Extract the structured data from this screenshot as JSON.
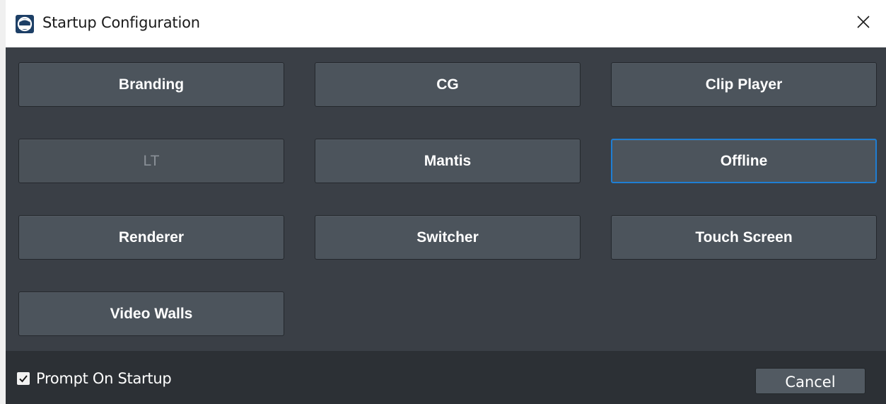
{
  "window": {
    "title": "Startup Configuration",
    "app_icon": "app-logo-icon",
    "close_icon": "close-icon"
  },
  "modes": {
    "branding": {
      "label": "Branding",
      "enabled": true
    },
    "cg": {
      "label": "CG",
      "enabled": true
    },
    "clip_player": {
      "label": "Clip Player",
      "enabled": true
    },
    "lt": {
      "label": "LT",
      "enabled": false
    },
    "mantis": {
      "label": "Mantis",
      "enabled": true
    },
    "offline": {
      "label": "Offline",
      "enabled": true,
      "focused": true
    },
    "renderer": {
      "label": "Renderer",
      "enabled": true
    },
    "switcher": {
      "label": "Switcher",
      "enabled": true
    },
    "touch_screen": {
      "label": "Touch Screen",
      "enabled": true
    },
    "video_walls": {
      "label": "Video Walls",
      "enabled": true
    }
  },
  "footer": {
    "prompt_label": "Prompt On Startup",
    "prompt_checked": true,
    "cancel_label": "Cancel"
  },
  "colors": {
    "background": "#3a3f46",
    "button": "#4c545c",
    "footer": "#2c3035",
    "focus_accent": "#1f7ed3",
    "disabled_text": "#8a9097"
  }
}
